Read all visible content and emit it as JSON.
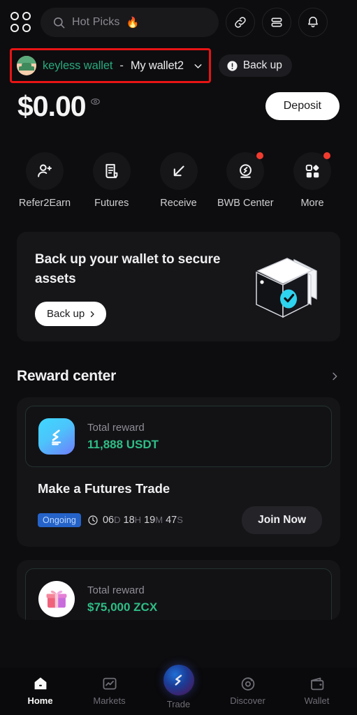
{
  "header": {
    "apps_icon": "grid-apps-icon",
    "search": {
      "placeholder": "Hot Picks",
      "flame": "🔥",
      "icon": "search-icon"
    },
    "icons": [
      {
        "name": "link-icon",
        "label": "Link"
      },
      {
        "name": "list-menu-icon",
        "label": "Menu"
      },
      {
        "name": "bell-icon",
        "label": "Notifications"
      }
    ]
  },
  "wallet": {
    "type_label": "keyless wallet",
    "separator": "-",
    "alias": "My wallet2",
    "chevron": "chevron-down-icon",
    "avatar": "wallet-avatar",
    "backup_pill": {
      "label": "Back up",
      "icon": "warning-icon"
    },
    "highlight_color": "#e81414",
    "type_color": "#29a97d"
  },
  "balance": {
    "amount": "$0.00",
    "eye_icon": "eye-icon",
    "deposit_label": "Deposit"
  },
  "quick_actions": [
    {
      "label": "Refer2Earn",
      "icon": "user-plus-icon",
      "badge": false
    },
    {
      "label": "Futures",
      "icon": "document-icon",
      "badge": false
    },
    {
      "label": "Receive",
      "icon": "arrow-down-left-icon",
      "badge": false
    },
    {
      "label": "BWB Center",
      "icon": "bwb-coin-icon",
      "badge": true
    },
    {
      "label": "More",
      "icon": "more-grid-icon",
      "badge": true
    }
  ],
  "backup_banner": {
    "title": "Back up your wallet to secure assets",
    "cta_label": "Back up",
    "cta_chevron": "chevron-right-icon",
    "art": "wallet-book-icon"
  },
  "reward_center": {
    "title": "Reward center",
    "chevron": "chevron-right-icon",
    "cards": [
      {
        "icon": "bitget-token-icon",
        "reward_label": "Total reward",
        "reward_value": "11,888 USDT",
        "task_title": "Make a Futures Trade",
        "status_badge": "Ongoing",
        "timer_icon": "clock-icon",
        "timer": [
          {
            "value": "06",
            "unit": "D"
          },
          {
            "value": "18",
            "unit": "H"
          },
          {
            "value": "19",
            "unit": "M"
          },
          {
            "value": "47",
            "unit": "S"
          }
        ],
        "join_label": "Join Now"
      },
      {
        "icon": "gift-icon",
        "reward_label": "Total reward",
        "reward_value": "$75,000 ZCX"
      }
    ]
  },
  "bottom_nav": [
    {
      "label": "Home",
      "icon": "home-icon",
      "active": true
    },
    {
      "label": "Markets",
      "icon": "chart-icon",
      "active": false
    },
    {
      "label": "Trade",
      "icon": "trade-orb-icon",
      "active": false
    },
    {
      "label": "Discover",
      "icon": "compass-icon",
      "active": false
    },
    {
      "label": "Wallet",
      "icon": "wallet-icon",
      "active": false
    }
  ]
}
